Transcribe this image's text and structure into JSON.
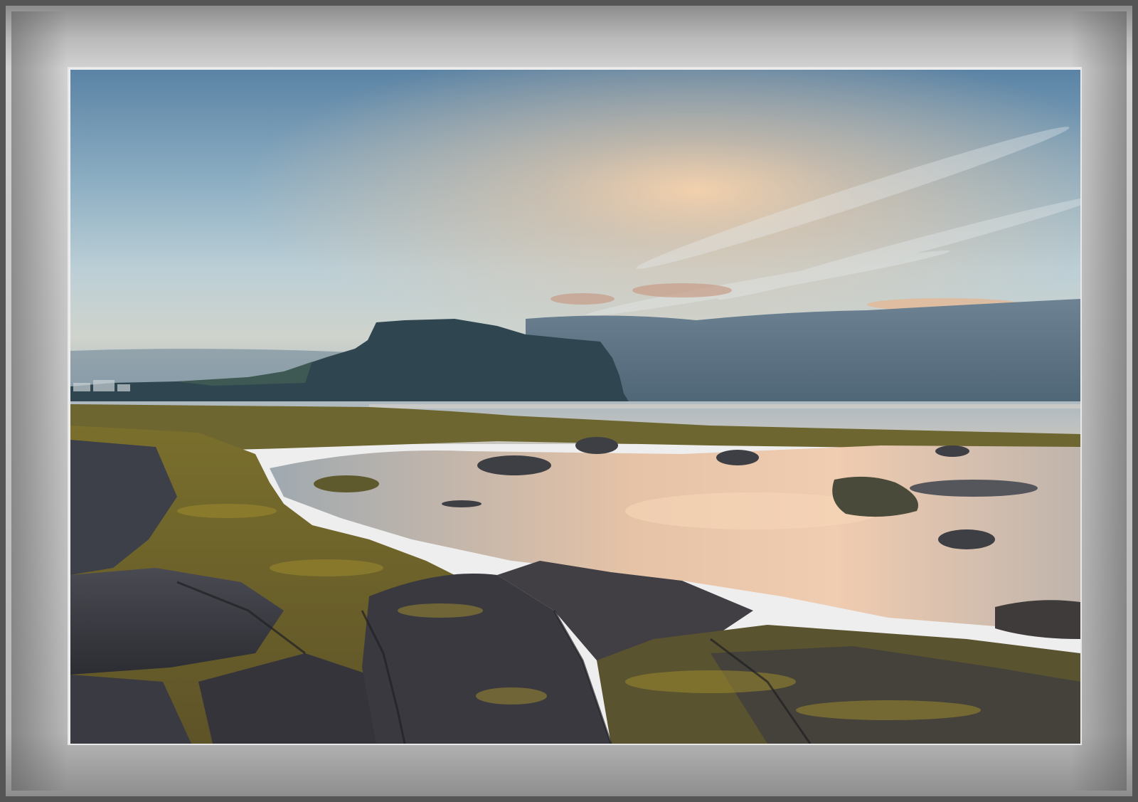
{
  "scene": {
    "colors": {
      "sky_top": "#5e86a8",
      "sky_mid": "#a9c2cf",
      "sky_glow": "#f2c9a1",
      "cloud_bank": "#5d7384",
      "headland": "#2f4550",
      "sea": "#b9c2c8",
      "pool_reflection": "#e8c6a8",
      "moss": "#8a7a2a",
      "rock_dark": "#3b3b44",
      "frame_light": "#d2d2d2",
      "frame_dark": "#555555"
    }
  }
}
